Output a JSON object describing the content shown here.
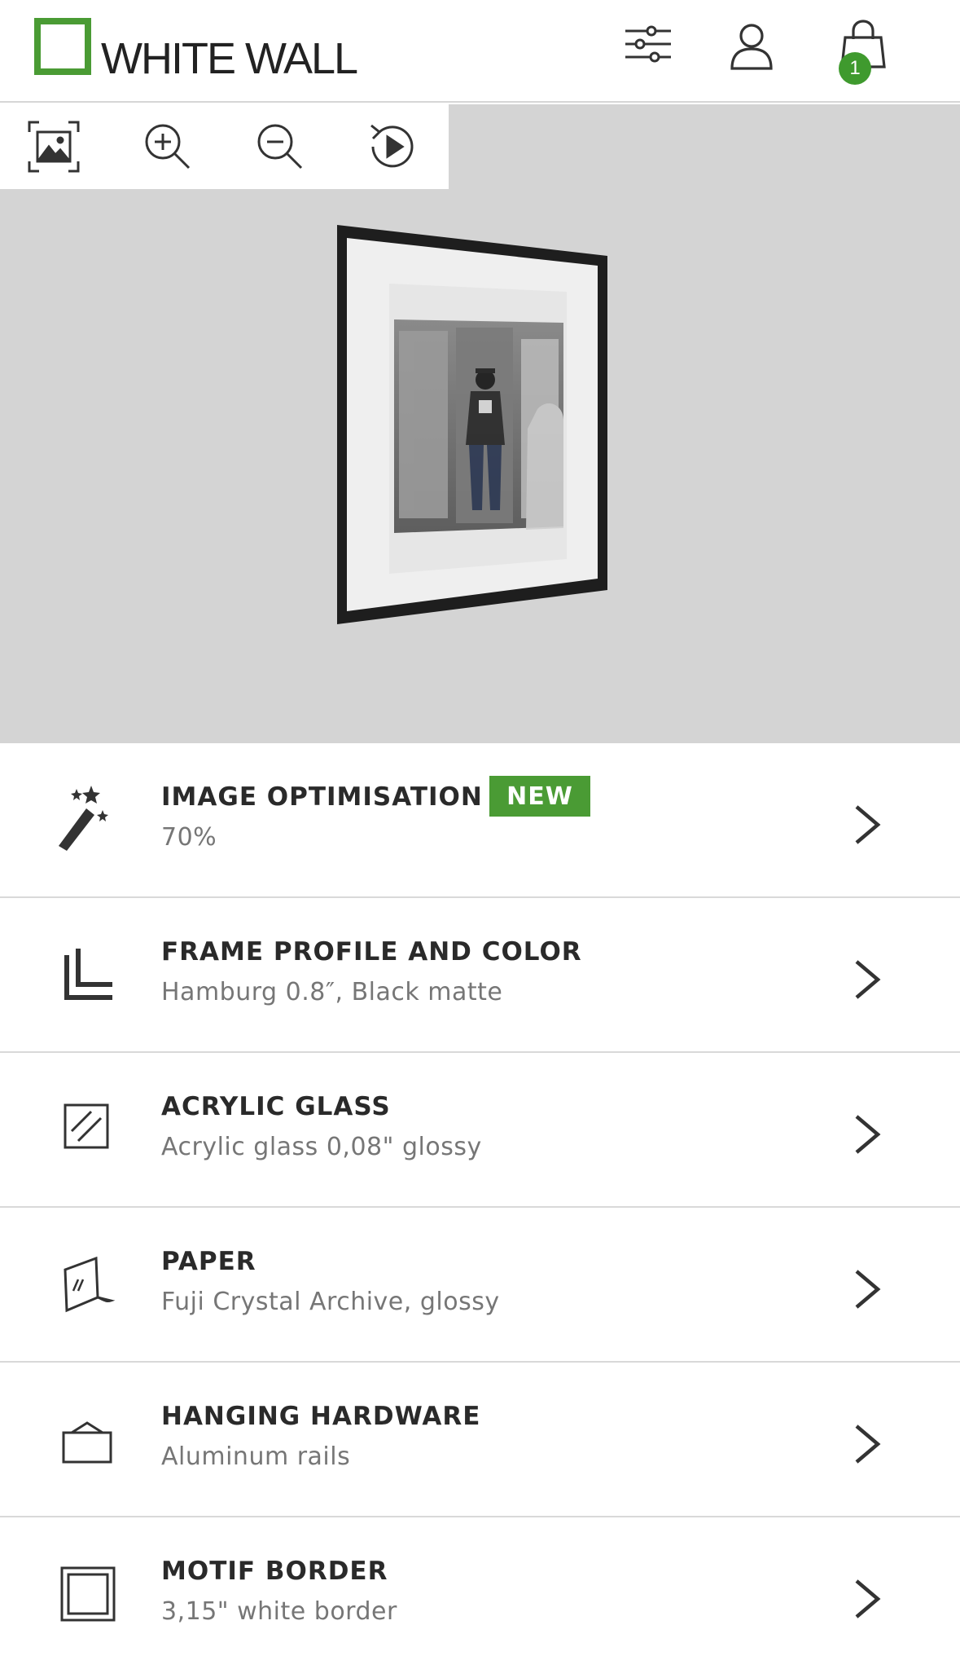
{
  "header": {
    "logo_text": "WHITE WALL",
    "cart_count": "1",
    "brand_color": "#4a9b34"
  },
  "toolbar": {
    "icons": [
      "fit-image-icon",
      "zoom-in-icon",
      "zoom-out-icon",
      "replay-icon"
    ]
  },
  "options": [
    {
      "title": "IMAGE OPTIMISATION",
      "subtitle": "70%",
      "badge": "NEW",
      "icon": "magic-wand-icon"
    },
    {
      "title": "FRAME PROFILE AND COLOR",
      "subtitle": "Hamburg 0.8″, Black matte",
      "icon": "frame-profile-icon"
    },
    {
      "title": "ACRYLIC GLASS",
      "subtitle": "Acrylic glass 0,08\" glossy",
      "icon": "glass-icon"
    },
    {
      "title": "PAPER",
      "subtitle": "Fuji Crystal Archive, glossy",
      "icon": "paper-icon"
    },
    {
      "title": "HANGING HARDWARE",
      "subtitle": "Aluminum rails",
      "icon": "hanging-hardware-icon"
    },
    {
      "title": "MOTIF BORDER",
      "subtitle": "3,15\" white border",
      "icon": "border-icon"
    }
  ]
}
